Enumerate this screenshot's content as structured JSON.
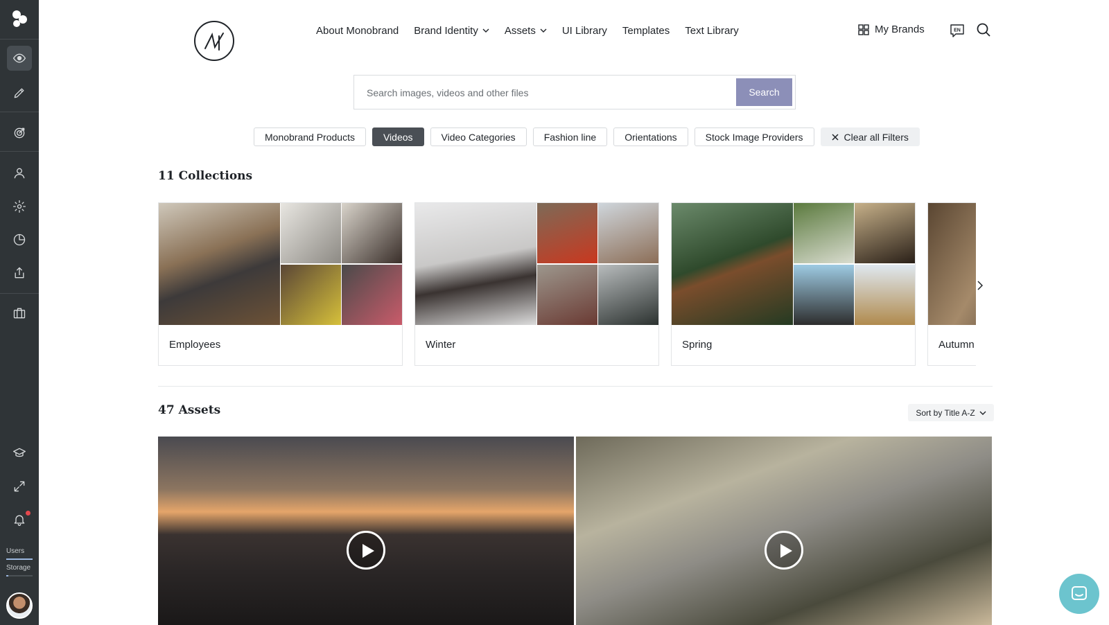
{
  "nav": {
    "links": [
      {
        "label": "About Monobrand",
        "dropdown": false
      },
      {
        "label": "Brand Identity",
        "dropdown": true
      },
      {
        "label": "Assets",
        "dropdown": true
      },
      {
        "label": "UI Library",
        "dropdown": false
      },
      {
        "label": "Templates",
        "dropdown": false
      },
      {
        "label": "Text Library",
        "dropdown": false
      }
    ],
    "my_brands": "My Brands",
    "language": "EN"
  },
  "search": {
    "placeholder": "Search images, videos and other files",
    "button": "Search"
  },
  "filters": {
    "chips": [
      "Monobrand Products",
      "Videos",
      "Video Categories",
      "Fashion line",
      "Orientations",
      "Stock Image Providers"
    ],
    "active": "Videos",
    "clear_label": "Clear all Filters"
  },
  "collections": {
    "heading": "11 Collections",
    "items": [
      {
        "title": "Employees"
      },
      {
        "title": "Winter"
      },
      {
        "title": "Spring"
      },
      {
        "title": "Autumn"
      }
    ]
  },
  "assets": {
    "heading": "47 Assets",
    "sort_label": "Sort by Title A-Z",
    "items": [
      "sunset-lake-video",
      "hillside-town-video"
    ]
  },
  "sidebar": {
    "users_label": "Users",
    "users_fraction": 1.0,
    "storage_label": "Storage",
    "storage_fraction": 0.08,
    "notification_dot": true
  },
  "colors": {
    "sidebar_bg": "#2f3437",
    "search_button": "#8c8fb8",
    "active_chip": "#4a4f55",
    "chat": "#6cc4ce"
  }
}
